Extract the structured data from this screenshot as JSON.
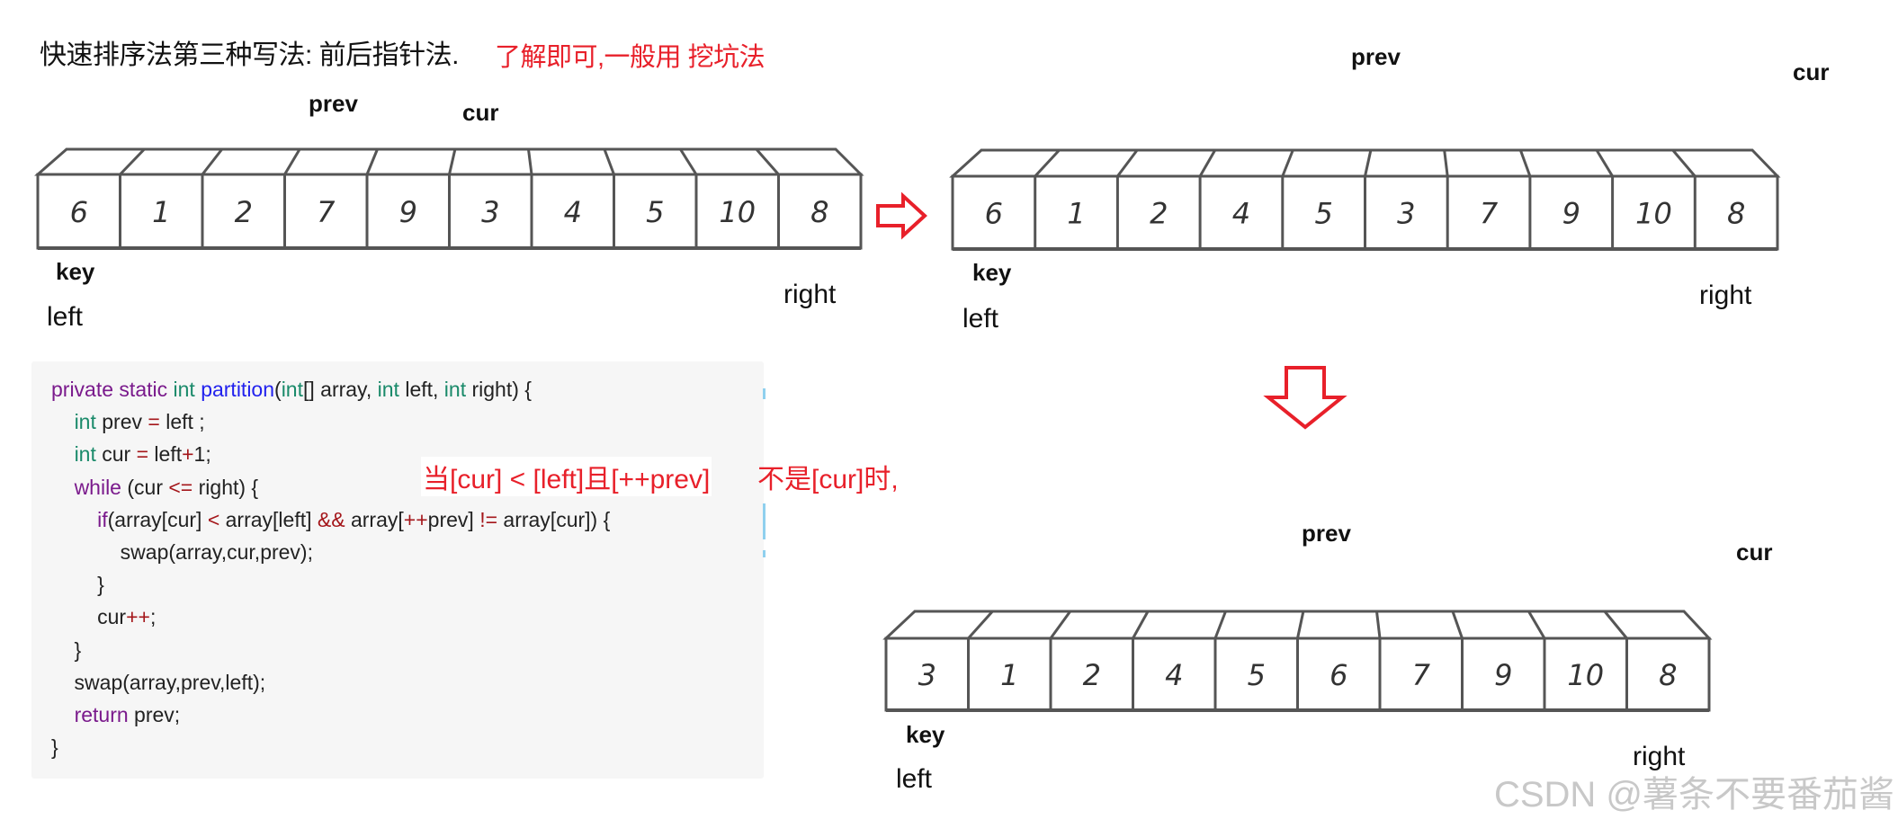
{
  "title": {
    "main": "快速排序法第三种写法: 前后指针法.",
    "note": "了解即可,一般用 挖坑法"
  },
  "arrays": [
    {
      "name": "initial",
      "values": [
        "6",
        "1",
        "2",
        "7",
        "9",
        "3",
        "4",
        "5",
        "10",
        "8"
      ],
      "highlight_index": null,
      "labels": {
        "prev": "prev",
        "cur": "cur",
        "key": "key",
        "left": "left",
        "right": "right"
      }
    },
    {
      "name": "after-swaps",
      "values": [
        "6",
        "1",
        "2",
        "4",
        "5",
        "3",
        "7",
        "9",
        "10",
        "8"
      ],
      "highlight_index": 6,
      "labels": {
        "prev": "prev",
        "cur": "cur",
        "key": "key",
        "left": "left",
        "right": "right"
      }
    },
    {
      "name": "final",
      "values": [
        "3",
        "1",
        "2",
        "4",
        "5",
        "6",
        "7",
        "9",
        "10",
        "8"
      ],
      "highlight_index": 5,
      "labels": {
        "prev": "prev",
        "cur": "cur",
        "key": "key",
        "left": "left",
        "right": "right"
      }
    }
  ],
  "arrows": {
    "right_arrow": "right-arrow-icon",
    "down_arrow": "down-arrow-icon",
    "color": "#e8202a"
  },
  "code": {
    "lines": [
      [
        {
          "t": "private static ",
          "c": "kw"
        },
        {
          "t": "int ",
          "c": "ty"
        },
        {
          "t": "partition",
          "c": "fn"
        },
        {
          "t": "(",
          "c": ""
        },
        {
          "t": "int",
          "c": "ty"
        },
        {
          "t": "[] array, ",
          "c": ""
        },
        {
          "t": "int ",
          "c": "ty"
        },
        {
          "t": "left, ",
          "c": ""
        },
        {
          "t": "int ",
          "c": "ty"
        },
        {
          "t": "right) {",
          "c": ""
        }
      ],
      [
        {
          "t": "    ",
          "c": ""
        },
        {
          "t": "int ",
          "c": "ty"
        },
        {
          "t": "prev ",
          "c": ""
        },
        {
          "t": "=",
          "c": "op"
        },
        {
          "t": " left ;",
          "c": ""
        }
      ],
      [
        {
          "t": "    ",
          "c": ""
        },
        {
          "t": "int ",
          "c": "ty"
        },
        {
          "t": "cur ",
          "c": ""
        },
        {
          "t": "=",
          "c": "op"
        },
        {
          "t": " left",
          "c": ""
        },
        {
          "t": "+",
          "c": "op"
        },
        {
          "t": "1;",
          "c": ""
        }
      ],
      [
        {
          "t": "    ",
          "c": ""
        },
        {
          "t": "while ",
          "c": "kw"
        },
        {
          "t": "(cur ",
          "c": ""
        },
        {
          "t": "<=",
          "c": "op"
        },
        {
          "t": " right) {",
          "c": ""
        }
      ],
      [
        {
          "t": "        ",
          "c": ""
        },
        {
          "t": "if",
          "c": "kw"
        },
        {
          "t": "(array[cur] ",
          "c": ""
        },
        {
          "t": "<",
          "c": "op"
        },
        {
          "t": " array[left] ",
          "c": ""
        },
        {
          "t": "&&",
          "c": "op"
        },
        {
          "t": " array[",
          "c": ""
        },
        {
          "t": "++",
          "c": "op"
        },
        {
          "t": "prev] ",
          "c": ""
        },
        {
          "t": "!=",
          "c": "op"
        },
        {
          "t": " array[cur]) {",
          "c": ""
        }
      ],
      [
        {
          "t": "            swap(array,cur,prev);",
          "c": ""
        }
      ],
      [
        {
          "t": "        }",
          "c": ""
        }
      ],
      [
        {
          "t": "        cur",
          "c": ""
        },
        {
          "t": "++",
          "c": "op"
        },
        {
          "t": ";",
          "c": ""
        }
      ],
      [
        {
          "t": "    }",
          "c": ""
        }
      ],
      [
        {
          "t": "    swap(array,prev,left);",
          "c": ""
        }
      ],
      [
        {
          "t": "    ",
          "c": ""
        },
        {
          "t": "return ",
          "c": "kw"
        },
        {
          "t": "prev;",
          "c": ""
        }
      ],
      [
        {
          "t": "}",
          "c": ""
        }
      ]
    ]
  },
  "annotation": {
    "part1": "当[cur] < [left]且[++prev]",
    "part2": "不是[cur]时,"
  },
  "watermark": "CSDN @薯条不要番茄酱"
}
